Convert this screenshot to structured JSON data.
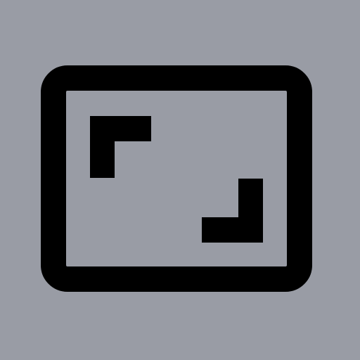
{
  "background_color": "#999ca5",
  "icon": {
    "name": "aspect-ratio-icon",
    "color": "#000000"
  }
}
